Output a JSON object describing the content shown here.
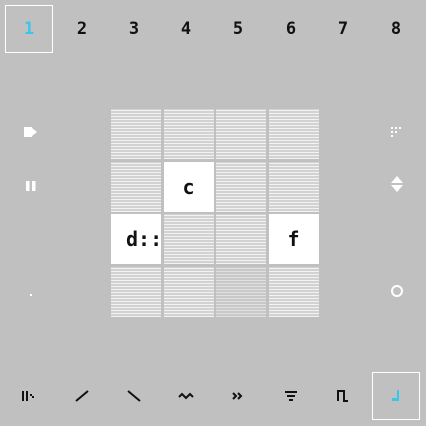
{
  "top_tabs": [
    {
      "label": "1",
      "selected": true
    },
    {
      "label": "2",
      "selected": false
    },
    {
      "label": "3",
      "selected": false
    },
    {
      "label": "4",
      "selected": false
    },
    {
      "label": "5",
      "selected": false
    },
    {
      "label": "6",
      "selected": false
    },
    {
      "label": "7",
      "selected": false
    },
    {
      "label": "8",
      "selected": false
    }
  ],
  "grid": {
    "cells": [
      {
        "label": "",
        "state": "empty"
      },
      {
        "label": "",
        "state": "empty"
      },
      {
        "label": "",
        "state": "empty"
      },
      {
        "label": "",
        "state": "empty"
      },
      {
        "label": "",
        "state": "empty"
      },
      {
        "label": "c",
        "state": "filled"
      },
      {
        "label": "",
        "state": "empty"
      },
      {
        "label": "",
        "state": "empty"
      },
      {
        "label": "d::",
        "state": "filled"
      },
      {
        "label": "",
        "state": "empty"
      },
      {
        "label": "",
        "state": "empty"
      },
      {
        "label": "f",
        "state": "filled"
      },
      {
        "label": "",
        "state": "empty"
      },
      {
        "label": "",
        "state": "empty"
      },
      {
        "label": "",
        "state": "dim"
      },
      {
        "label": "",
        "state": "empty"
      }
    ]
  },
  "left_controls": [
    "play-icon",
    "pause-icon",
    "dot-icon"
  ],
  "right_controls": [
    "dots-grid-icon",
    "up-down-arrows-icon",
    "circle-icon"
  ],
  "bottom_tools": [
    {
      "name": "bars-tool-icon",
      "selected": false
    },
    {
      "name": "line-up-tool-icon",
      "selected": false
    },
    {
      "name": "line-down-tool-icon",
      "selected": false
    },
    {
      "name": "wave-tool-icon",
      "selected": false
    },
    {
      "name": "fast-forward-tool-icon",
      "selected": false
    },
    {
      "name": "filter-tool-icon",
      "selected": false
    },
    {
      "name": "pulse-tool-icon",
      "selected": false
    },
    {
      "name": "note-tool-icon",
      "selected": true
    }
  ],
  "colors": {
    "accent": "#39c6e8",
    "background": "#c0c0c0"
  }
}
